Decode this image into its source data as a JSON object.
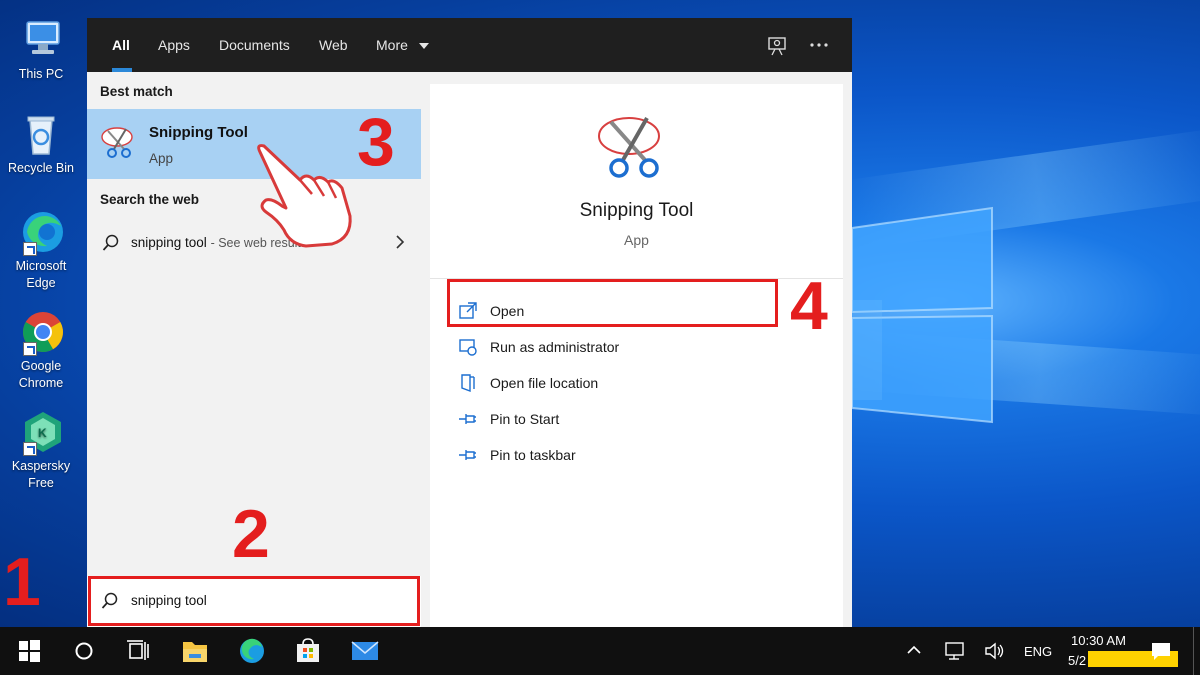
{
  "desktop": {
    "icons": [
      {
        "label": "This PC",
        "icon": "this-pc-icon"
      },
      {
        "label": "Recycle Bin",
        "icon": "recycle-bin-icon"
      },
      {
        "label": "Microsoft Edge",
        "icon": "edge-icon"
      },
      {
        "label": "Google Chrome",
        "icon": "chrome-icon"
      },
      {
        "label": "Kaspersky Free",
        "icon": "kaspersky-icon"
      }
    ],
    "labels": {
      "this_pc_1": "This PC",
      "recycle_1": "Recycle Bin",
      "edge_1": "Microsoft",
      "edge_2": "Edge",
      "chrome_1": "Google",
      "chrome_2": "Chrome",
      "kasp_1": "Kaspersky",
      "kasp_2": "Free"
    }
  },
  "search_menu": {
    "tabs": [
      {
        "label": "All",
        "active": true
      },
      {
        "label": "Apps"
      },
      {
        "label": "Documents"
      },
      {
        "label": "Web"
      },
      {
        "label": "More"
      }
    ],
    "best_match_heading": "Best match",
    "best_match": {
      "name": "Snipping Tool",
      "type": "App"
    },
    "search_web_heading": "Search the web",
    "web_result": {
      "query": "snipping tool",
      "suffix": "- See web results"
    },
    "detail": {
      "name": "Snipping Tool",
      "type": "App",
      "actions": [
        {
          "label": "Open",
          "icon": "open-icon"
        },
        {
          "label": "Run as administrator",
          "icon": "run-as-admin-icon"
        },
        {
          "label": "Open file location",
          "icon": "file-location-icon"
        },
        {
          "label": "Pin to Start",
          "icon": "pin-icon"
        },
        {
          "label": "Pin to taskbar",
          "icon": "pin-icon"
        }
      ]
    },
    "search_input": {
      "value": "snipping tool"
    }
  },
  "steps": {
    "s1": "1",
    "s2": "2",
    "s3": "3",
    "s4": "4"
  },
  "taskbar": {
    "language": "ENG",
    "time": "10:30 AM",
    "date": "5/2"
  },
  "colors": {
    "accent": "#2b88d8",
    "selection": "#a8d1f3",
    "highlight_red": "#e41e1e",
    "taskbar": "#101010"
  }
}
